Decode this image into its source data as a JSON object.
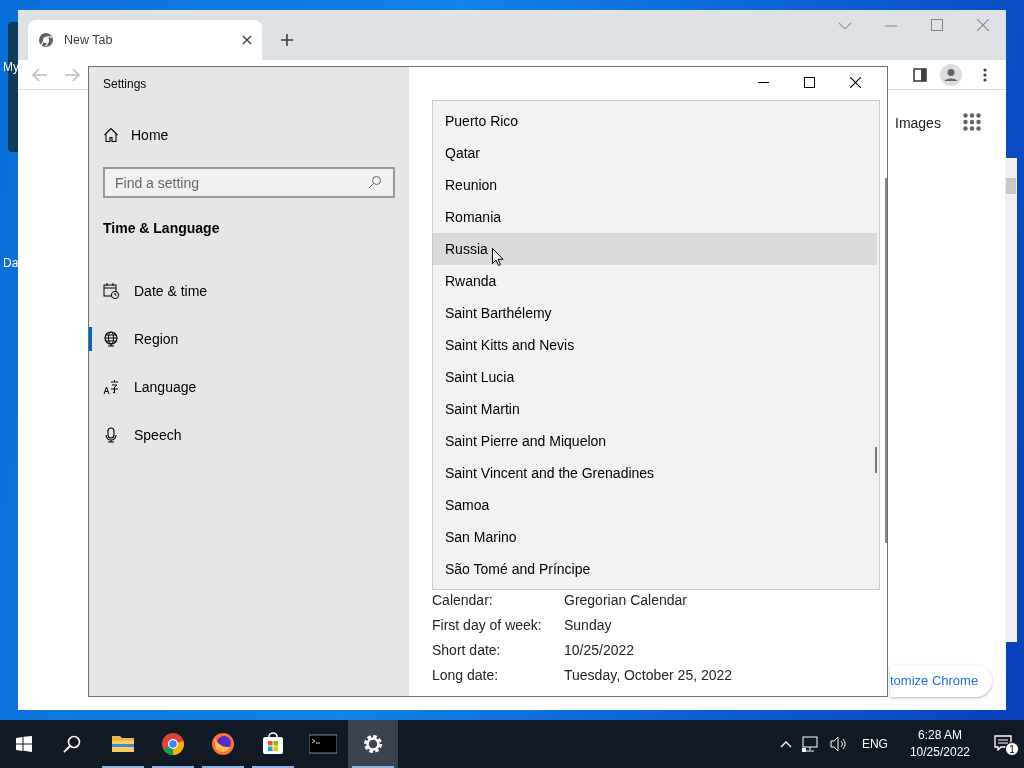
{
  "desktop": {
    "icon_labels": [
      "My",
      "Da"
    ]
  },
  "browser": {
    "tabs": [
      {
        "title": "New Tab",
        "selected": true
      }
    ],
    "header_link": "Images",
    "customize_button": "tomize Chrome"
  },
  "settings": {
    "title": "Settings",
    "home": "Home",
    "search": {
      "placeholder": "Find a setting"
    },
    "section": "Time & Language",
    "nav": [
      {
        "label": "Date & time",
        "kind": "calendar",
        "selected": false
      },
      {
        "label": "Region",
        "kind": "globe",
        "selected": true
      },
      {
        "label": "Language",
        "kind": "language",
        "selected": false
      },
      {
        "label": "Speech",
        "kind": "mic",
        "selected": false
      }
    ],
    "country_list": [
      {
        "label": "Puerto Rico",
        "selected": false
      },
      {
        "label": "Qatar",
        "selected": false
      },
      {
        "label": "Reunion",
        "selected": false
      },
      {
        "label": "Romania",
        "selected": false
      },
      {
        "label": "Russia",
        "selected": true
      },
      {
        "label": "Rwanda",
        "selected": false
      },
      {
        "label": "Saint Barthélemy",
        "selected": false
      },
      {
        "label": "Saint Kitts and Nevis",
        "selected": false
      },
      {
        "label": "Saint Lucia",
        "selected": false
      },
      {
        "label": "Saint Martin",
        "selected": false
      },
      {
        "label": "Saint Pierre and Miquelon",
        "selected": false
      },
      {
        "label": "Saint Vincent and the Grenadines",
        "selected": false
      },
      {
        "label": "Samoa",
        "selected": false
      },
      {
        "label": "San Marino",
        "selected": false
      },
      {
        "label": "São Tomé and Príncipe",
        "selected": false
      }
    ],
    "formats": [
      {
        "label": "Calendar:",
        "value": "Gregorian Calendar"
      },
      {
        "label": "First day of week:",
        "value": "Sunday"
      },
      {
        "label": "Short date:",
        "value": "10/25/2022"
      },
      {
        "label": "Long date:",
        "value": "Tuesday, October 25, 2022"
      }
    ]
  },
  "taskbar": {
    "apps": [
      {
        "kind": "folder",
        "running": true,
        "selected": false
      },
      {
        "kind": "chrome",
        "running": true,
        "selected": false
      },
      {
        "kind": "firefox",
        "running": true,
        "selected": false
      },
      {
        "kind": "store",
        "running": true,
        "selected": false
      },
      {
        "kind": "terminal",
        "running": false,
        "selected": false
      },
      {
        "kind": "gear",
        "running": true,
        "selected": true
      }
    ],
    "language": "ENG",
    "time": "6:28 AM",
    "date": "10/25/2022",
    "notifications": "1"
  }
}
